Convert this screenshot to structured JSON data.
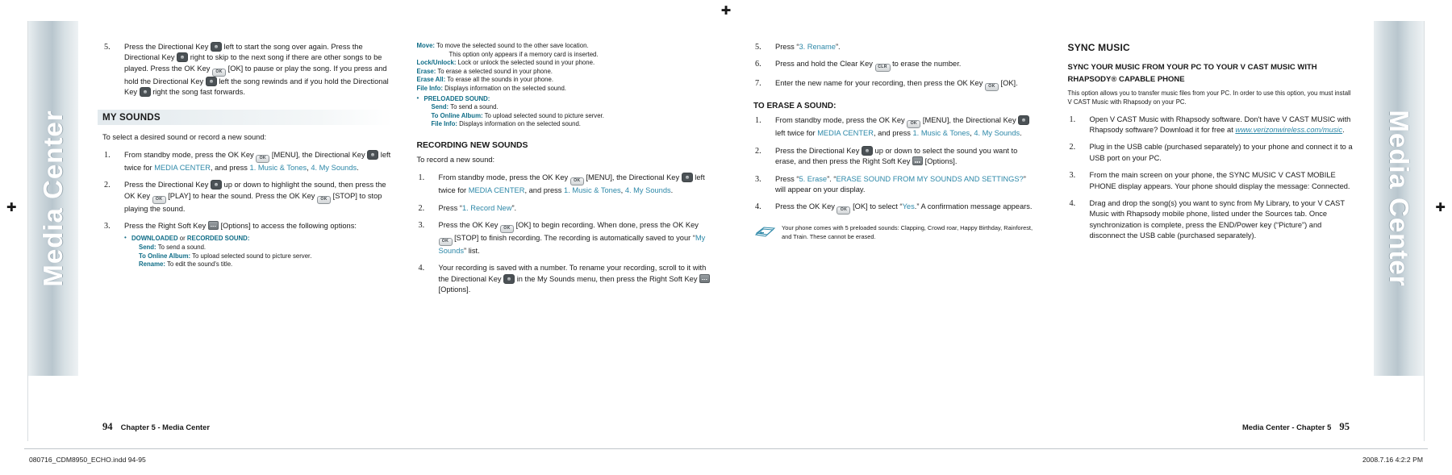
{
  "document": {
    "left_band_text": "Media Center",
    "right_band_text": "Media Center"
  },
  "print_footer": {
    "left": "080716_CDM8950_ECHO.indd   94-95",
    "right": "2008.7.16   4:2:2 PM"
  },
  "folios": {
    "left_page_number": "94",
    "left_chapter": "Chapter 5 - Media Center",
    "right_chapter": "Media Center - Chapter 5",
    "right_page_number": "95"
  },
  "column1": {
    "step5": {
      "num": "5.",
      "p1": "Press the Directional Key ",
      "p2": " left to start the song over again. Press the Directional Key ",
      "p3": " right to skip to the next song if there are other songs to be played. Press the OK Key ",
      "p4": " [OK] to pause or play the song. If you press and hold the Directional Key ",
      "p5": " left the song rewinds and if you hold the Directional Key ",
      "p6": " right the song fast forwards."
    },
    "section_title": "MY SOUNDS",
    "lead": "To select a desired sound or record a new sound:",
    "steps": [
      {
        "num": "1.",
        "a": "From standby mode, press the OK Key ",
        "b": " [MENU], the Directional Key ",
        "c": " left twice for ",
        "link1": "MEDIA CENTER",
        "d": ", and press ",
        "link2": "1. Music & Tones",
        "e": ", ",
        "link3": "4. My Sounds",
        "f": "."
      },
      {
        "num": "2.",
        "a": "Press the Directional Key ",
        "b": " up or down to highlight the sound, then press the OK Key ",
        "c": " [PLAY] to hear the sound. Press the OK Key ",
        "d": " [STOP] to stop playing the sound."
      },
      {
        "num": "3.",
        "a": "Press the Right Soft Key ",
        "b": " [Options] to access the following options:"
      }
    ],
    "bullet_head": "DOWNLOADED",
    "bullet_head_or": " or ",
    "bullet_head2": "RECORDED SOUND:",
    "defs": [
      {
        "term": "Send:",
        "desc": " To send a sound."
      },
      {
        "term": "To Online Album:",
        "desc": " To upload selected sound to picture server."
      },
      {
        "term": "Rename:",
        "desc": " To edit the sound's title."
      }
    ]
  },
  "column2": {
    "defs_top": [
      {
        "term": "Move:",
        "desc": " To move the selected sound to the other save location."
      },
      {
        "term": "",
        "desc": "This option only appears if a memory card is inserted.",
        "indent": true
      },
      {
        "term": "Lock/Unlock:",
        "desc": " Lock or unlock the selected sound in your phone."
      },
      {
        "term": "Erase:",
        "desc": " To erase a selected sound in your phone."
      },
      {
        "term": "Erase All:",
        "desc": " To erase all the sounds in your phone."
      },
      {
        "term": "File Info:",
        "desc": " Displays information on the selected sound."
      }
    ],
    "bullet_head": "PRELOADED SOUND:",
    "defs_bottom": [
      {
        "term": "Send:",
        "desc": " To send a sound."
      },
      {
        "term": "To Online Album:",
        "desc": " To upload selected sound to picture server."
      },
      {
        "term": "File Info:",
        "desc": " Displays information on the selected sound."
      }
    ],
    "section_title": "RECORDING NEW SOUNDS",
    "lead": "To record a new sound:",
    "steps": [
      {
        "num": "1.",
        "a": "From standby mode, press the OK Key ",
        "b": " [MENU], the Directional Key ",
        "c": " left twice for ",
        "link1": "MEDIA CENTER",
        "d": ", and press ",
        "link2": "1. Music & Tones",
        "e": ", ",
        "link3": "4. My Sounds",
        "f": "."
      },
      {
        "num": "2.",
        "a": "Press “",
        "link1": "1. Record New",
        "b": "”."
      },
      {
        "num": "3.",
        "a": "Press the OK Key ",
        "b": " [OK] to begin recording. When done, press the OK Key ",
        "c": " [STOP] to finish recording. The recording is automatically saved to your “",
        "link1": "My Sounds",
        "d": "” list."
      },
      {
        "num": "4.",
        "a": "Your recording is saved with a number. To rename your recording, scroll to it with the Directional Key ",
        "b": " in the My Sounds menu, then press the Right Soft Key ",
        "c": " [Options]."
      }
    ]
  },
  "column3": {
    "steps_top": [
      {
        "num": "5.",
        "a": "Press “",
        "link1": "3. Rename",
        "b": "”."
      },
      {
        "num": "6.",
        "a": "Press and hold the Clear Key ",
        "b": " to erase the number."
      },
      {
        "num": "7.",
        "a": "Enter the new name for your recording, then press the OK Key ",
        "b": " [OK]."
      }
    ],
    "section_title": "TO ERASE A SOUND:",
    "steps": [
      {
        "num": "1.",
        "a": "From standby mode, press the OK Key ",
        "b": " [MENU], the Directional Key ",
        "c": " left twice for ",
        "link1": "MEDIA CENTER",
        "d": ", and press ",
        "link2": "1. Music & Tones",
        "e": ", ",
        "link3": "4. My Sounds",
        "f": "."
      },
      {
        "num": "2.",
        "a": "Press the Directional Key ",
        "b": " up or down to select the sound you want to erase, and then press the Right Soft Key ",
        "c": " [Options]."
      },
      {
        "num": "3.",
        "a": "Press “",
        "link1": "5. Erase",
        "b": "”. “",
        "link2": "ERASE SOUND FROM MY SOUNDS AND SETTINGS?",
        "c": "” will appear on your display."
      },
      {
        "num": "4.",
        "a": "Press the OK Key ",
        "b": " [OK] to select “",
        "link1": "Yes",
        "c": ".” A confirmation message appears."
      }
    ],
    "note": "Your phone comes with 5 preloaded sounds: Clapping, Crowd roar, Happy Birthday, Rainforest, and Train. These cannot be erased."
  },
  "column4": {
    "section_title": "SYNC MUSIC",
    "sub_title_line1": "SYNC YOUR MUSIC FROM YOUR PC TO YOUR V CAST MUSIC WITH",
    "sub_title_line2": "RHAPSODY®  CAPABLE PHONE",
    "paragraph": "This option allows you to transfer music files from your PC. In order to use this option, you must install V CAST Music with Rhapsody on your PC.",
    "steps": [
      {
        "num": "1.",
        "a": "Open V CAST Music with Rhapsody software. Don't have V CAST MUSIC with Rhapsody software? Download it for free at ",
        "link": "www.verizonwireless.com/music",
        "b": "."
      },
      {
        "num": "2.",
        "a": "Plug in the USB cable (purchased separately) to your phone and connect it to a USB port on your PC."
      },
      {
        "num": "3.",
        "a": "From the main screen on your phone, the SYNC MUSIC V CAST MOBILE PHONE display appears. Your phone should display the message: Connected."
      },
      {
        "num": "4.",
        "a": "Drag and drop the song(s) you want to sync from My Library, to your V CAST Music with Rhapsody mobile phone, listed under the Sources tab. Once synchronization is complete, press the END/Power key (“Picture”) and disconnect the USB cable (purchased separately)."
      }
    ]
  },
  "keys": {
    "ok_label": "OK",
    "clear_label": "CLR"
  }
}
